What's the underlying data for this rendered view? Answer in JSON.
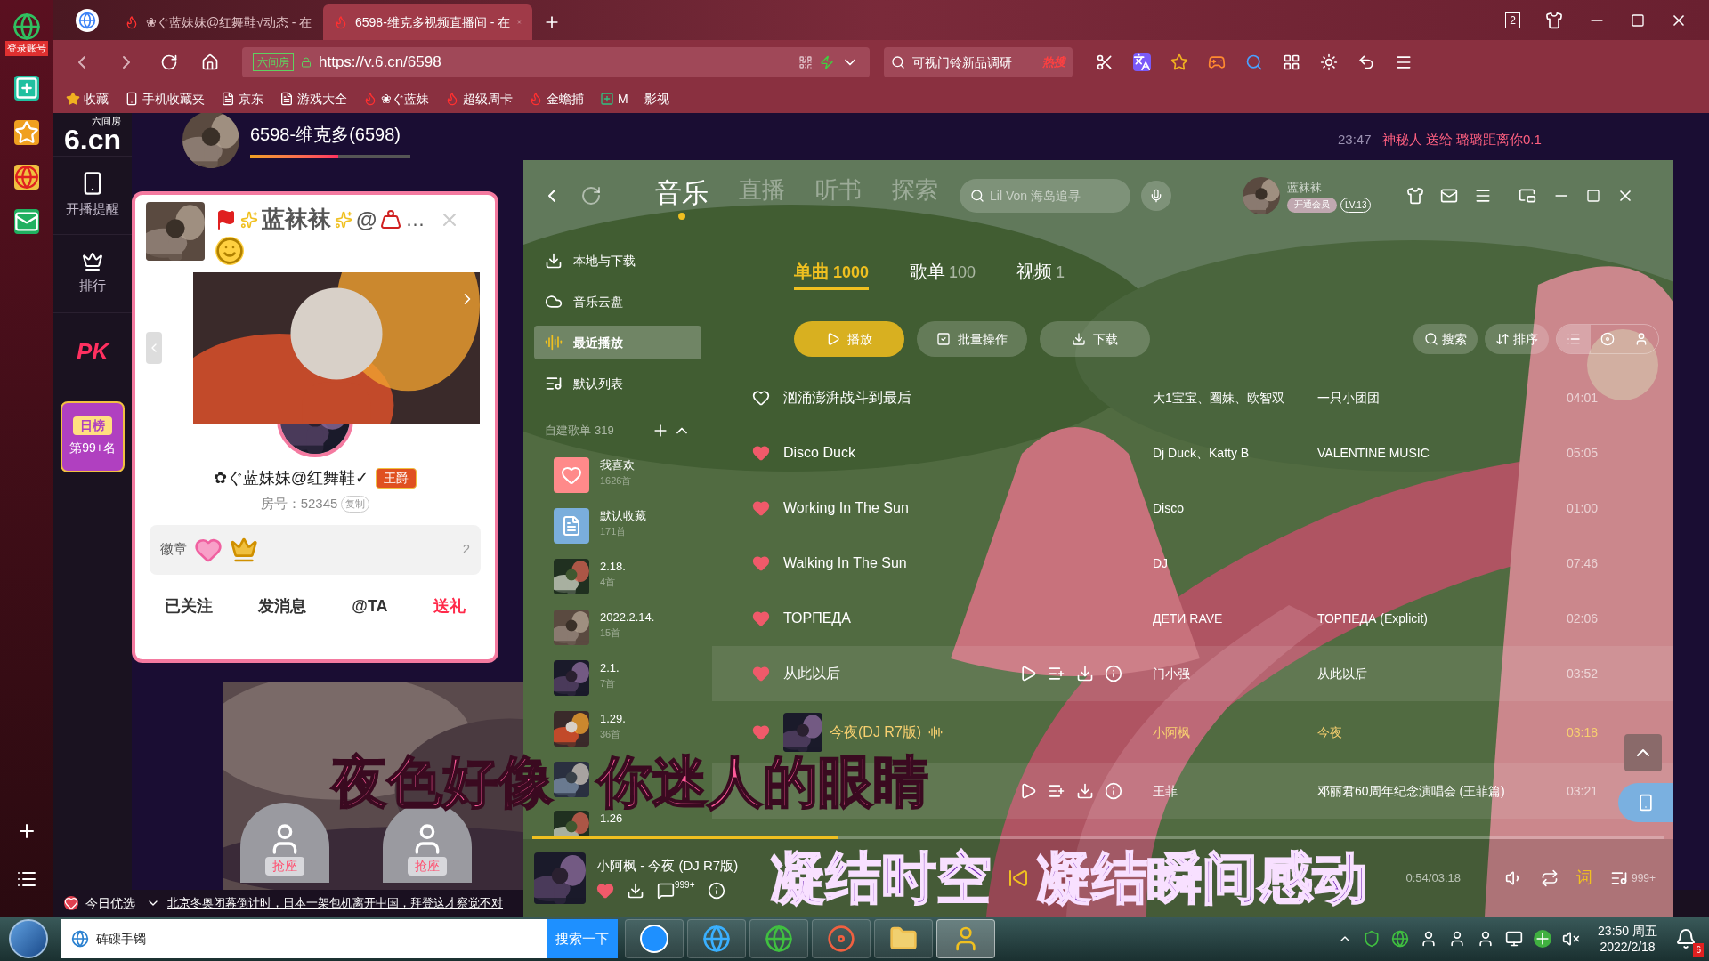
{
  "side_strip": {
    "login_label": "登录账号"
  },
  "browser": {
    "tabs": [
      {
        "title": "❀ぐ蓝妹妹@红舞鞋√动态 - 在",
        "selected": false
      },
      {
        "title": "6598-维克多视频直播间 - 在",
        "selected": true
      }
    ],
    "tab_count": "2",
    "address": {
      "site_badge": "六间房",
      "url": "https://v.6.cn/6598"
    },
    "search": {
      "value": "可视门铃新品调研",
      "hot_label": "热搜"
    },
    "bookmarks": [
      {
        "label": "收藏",
        "kind": "star"
      },
      {
        "label": "手机收藏夹",
        "kind": "phone"
      },
      {
        "label": "京东",
        "kind": "page"
      },
      {
        "label": "游戏大全",
        "kind": "page"
      },
      {
        "label": "❀ぐ蓝妹",
        "kind": "site"
      },
      {
        "label": "超级周卡",
        "kind": "site"
      },
      {
        "label": "金蟾捕",
        "kind": "site"
      },
      {
        "label": "M",
        "kind": "app"
      },
      {
        "label": "影视",
        "kind": "plain"
      }
    ]
  },
  "site": {
    "logo": "6.cn",
    "logo_sub": "六间房",
    "nav": [
      {
        "label": "开播提醒",
        "kind": "phone"
      },
      {
        "label": "排行",
        "kind": "crown"
      },
      {
        "label": "PK",
        "kind": "pk"
      }
    ],
    "rank_badge": {
      "title": "日榜",
      "value": "第99+名"
    },
    "host": {
      "name": "6598-维克多(6598)",
      "level": 0.55
    },
    "chat": {
      "time": "23:47",
      "message": "神秘人 送给 璐璐距离你0.1"
    },
    "seats": [
      "抢座",
      "抢座"
    ],
    "ticker": {
      "label": "今日优选",
      "headline": "北京冬奥闭幕倒计时，日本一架包机离开中国，拜登这才察觉不对"
    }
  },
  "profile_card": {
    "name": "蓝袜袜",
    "name_suffix": "@",
    "more": "…",
    "nickname": "✿ぐ蓝妹妹@红舞鞋✓",
    "title_badge": "王爵",
    "room": "房号：52345",
    "copy": "复制",
    "badges_label": "徽章",
    "badge_count": "2",
    "actions": [
      {
        "label": "已关注",
        "highlight": false
      },
      {
        "label": "发消息",
        "highlight": false
      },
      {
        "label": "@TA",
        "highlight": false
      },
      {
        "label": "送礼",
        "highlight": true
      }
    ]
  },
  "player": {
    "nav_tabs": [
      {
        "label": "音乐",
        "selected": true
      },
      {
        "label": "直播",
        "selected": false
      },
      {
        "label": "听书",
        "selected": false
      },
      {
        "label": "探索",
        "selected": false
      }
    ],
    "search_placeholder": "Lil Von 海岛追寻",
    "user": {
      "name": "蓝袜袜",
      "vip": "开通会员",
      "level": "LV.13"
    },
    "sidebar": [
      {
        "label": "本地与下载",
        "selected": false
      },
      {
        "label": "音乐云盘",
        "selected": false
      },
      {
        "label": "最近播放",
        "selected": true
      },
      {
        "label": "默认列表",
        "selected": false
      }
    ],
    "playlists_header": {
      "label": "自建歌单",
      "count": "319"
    },
    "playlists": [
      {
        "name": "我喜欢",
        "count": "1626首",
        "kind": "favorites"
      },
      {
        "name": "默认收藏",
        "count": "171首",
        "kind": "collection"
      },
      {
        "name": "2.18.",
        "count": "4首",
        "kind": "custom"
      },
      {
        "name": "2022.2.14.",
        "count": "15首",
        "kind": "custom"
      },
      {
        "name": "2.1.",
        "count": "7首",
        "kind": "custom"
      },
      {
        "name": "1.29.",
        "count": "36首",
        "kind": "custom"
      },
      {
        "kind": "custom"
      },
      {
        "name": "1.26",
        "kind": "custom"
      }
    ],
    "content_tabs": [
      {
        "label": "单曲",
        "count": "1000",
        "selected": true
      },
      {
        "label": "歌单",
        "count": "100",
        "selected": false
      },
      {
        "label": "视频",
        "count": "1",
        "selected": false
      }
    ],
    "actions": [
      {
        "label": "播放",
        "kind": "primary"
      },
      {
        "label": "批量操作",
        "kind": "plain"
      },
      {
        "label": "下载",
        "kind": "plain"
      }
    ],
    "tools": [
      "搜索",
      "排序"
    ],
    "view_modes": [
      {
        "kind": "list",
        "selected": true
      },
      {
        "kind": "disc",
        "selected": false
      },
      {
        "kind": "user",
        "selected": false
      }
    ],
    "songs": [
      {
        "title": "汹涌澎湃战斗到最后",
        "liked": false,
        "artist": "大1宝宝、圈妹、欧智双",
        "album": "一只小团团",
        "duration": "04:01",
        "hovered": false,
        "playing": false
      },
      {
        "title": "Disco Duck",
        "liked": true,
        "artist": "Dj Duck、Katty B",
        "album": "VALENTINE MUSIC",
        "duration": "05:05",
        "hovered": false,
        "playing": false
      },
      {
        "title": "Working In The Sun",
        "liked": true,
        "artist": "Disco",
        "duration": "01:00",
        "hovered": false,
        "playing": false
      },
      {
        "title": "Walking In The Sun",
        "liked": true,
        "artist": "DJ",
        "duration": "07:46",
        "hovered": false,
        "playing": false
      },
      {
        "title": "ТОРПЕДА",
        "liked": true,
        "artist": "ДЕТИ RAVE",
        "album": "ТОРПЕДА (Explicit)",
        "duration": "02:06",
        "hovered": false,
        "playing": false
      },
      {
        "title": "从此以后",
        "liked": true,
        "artist": "门小强",
        "album": "从此以后",
        "duration": "03:52",
        "hovered": true,
        "playing": false
      },
      {
        "title": "今夜(DJ R7版)",
        "liked": true,
        "artist": "小阿枫",
        "album": "今夜",
        "duration": "03:18",
        "hovered": false,
        "playing": true
      },
      {
        "artist": "王菲",
        "album": "邓丽君60周年纪念演唱会 (王菲篇)",
        "duration": "03:21",
        "hovered": true,
        "playing": false
      }
    ],
    "now_playing": {
      "title": "小阿枫 - 今夜 (DJ R7版)",
      "comment_count": "999+",
      "time": "0:54/03:18",
      "level": 0.27,
      "lyrics_label": "词",
      "queue_count": "999+"
    }
  },
  "lyrics": [
    [
      "夜色好像",
      "你迷人的眼睛"
    ],
    [
      "凝结时空",
      "凝结瞬间感动"
    ]
  ],
  "taskbar": {
    "search_value": "砗磲手镯",
    "search_button": "搜索一下",
    "apps": [
      {
        "kind": "k",
        "selected": false
      },
      {
        "kind": "ie",
        "selected": false
      },
      {
        "kind": "browser",
        "selected": false
      },
      {
        "kind": "colors",
        "selected": false
      },
      {
        "kind": "folder",
        "selected": false
      },
      {
        "kind": "avatar",
        "selected": true
      }
    ],
    "clock_time": "23:50 周五",
    "clock_date": "2022/2/18",
    "notification_count": "6"
  }
}
